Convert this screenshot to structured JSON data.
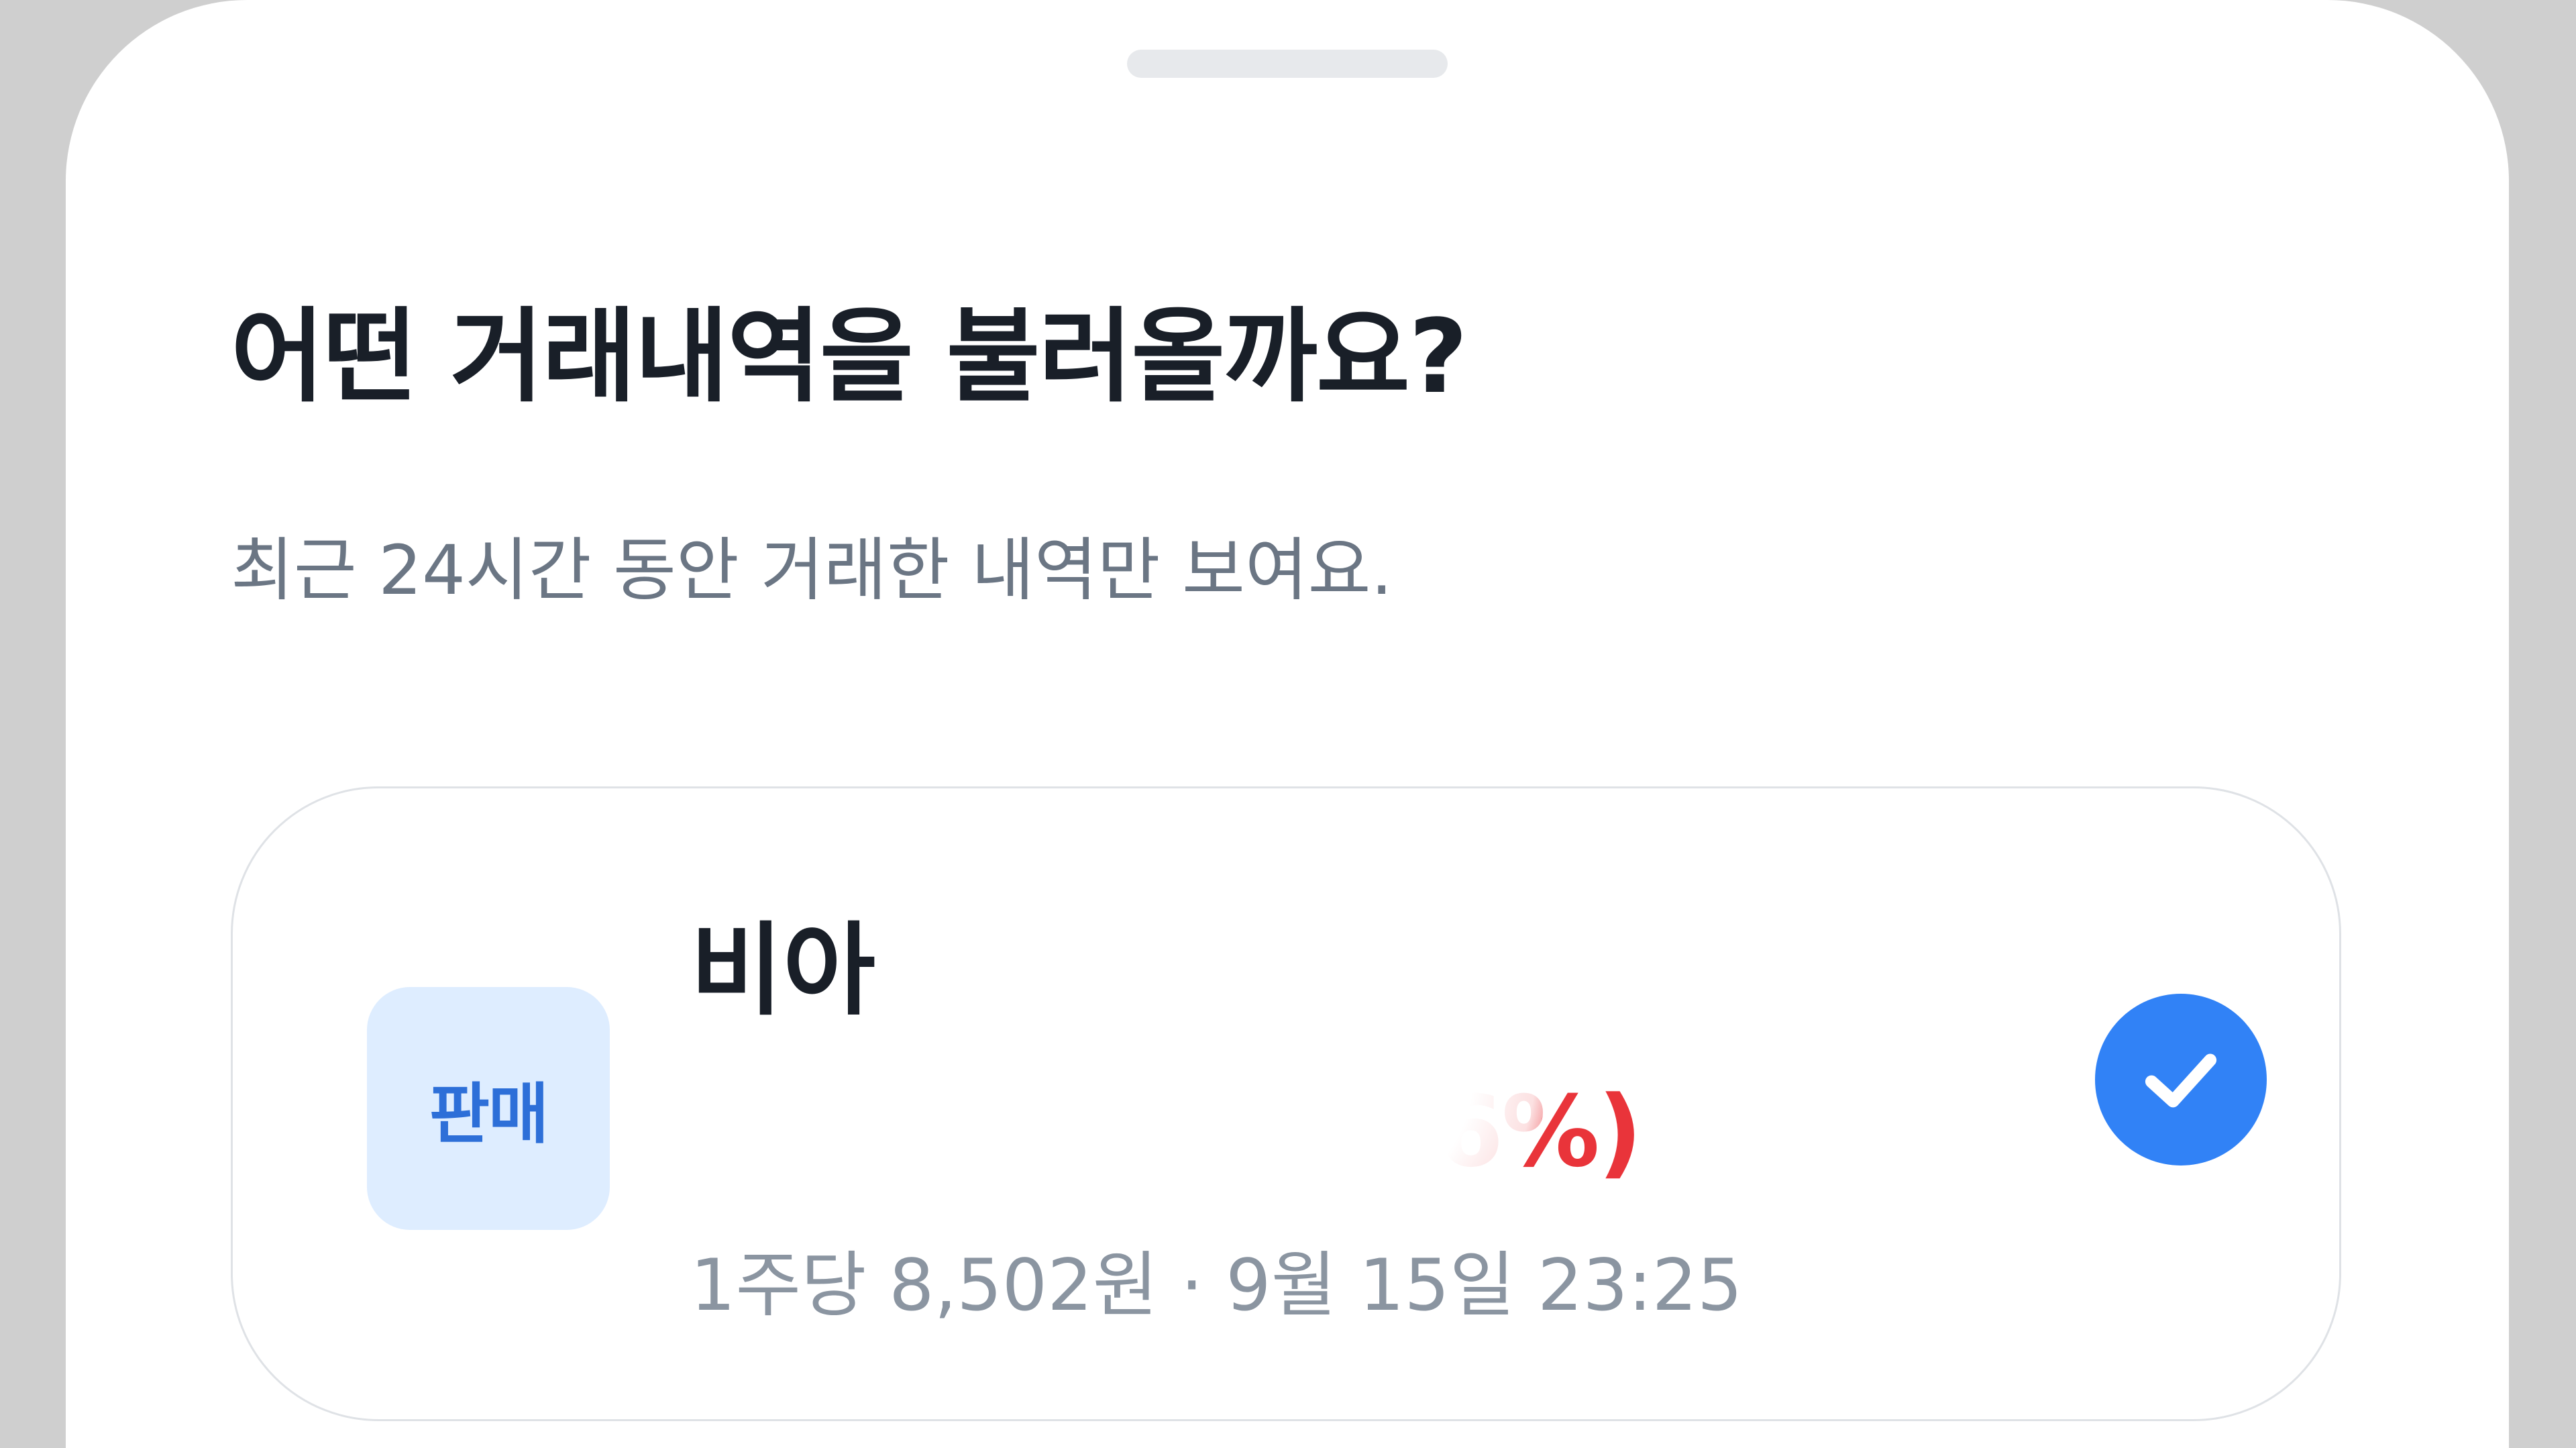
{
  "sheet": {
    "title": "어떤 거래내역을 불러올까요?",
    "subtitle": "최근 24시간 동안 거래한 내역만 보여요."
  },
  "trade": {
    "type_label": "판매",
    "stock_name": "비아",
    "profit_text": "(3.6%)",
    "detail": "1주당 8,502원 · 9월 15일 23:25",
    "selected": true
  },
  "colors": {
    "title": "#191f28",
    "subtitle": "#6b7684",
    "badge_bg": "#deedff",
    "badge_text": "#2d6fd8",
    "profit": "#e9343a",
    "check": "#3182f6"
  },
  "icons": {
    "check": "check-icon"
  }
}
